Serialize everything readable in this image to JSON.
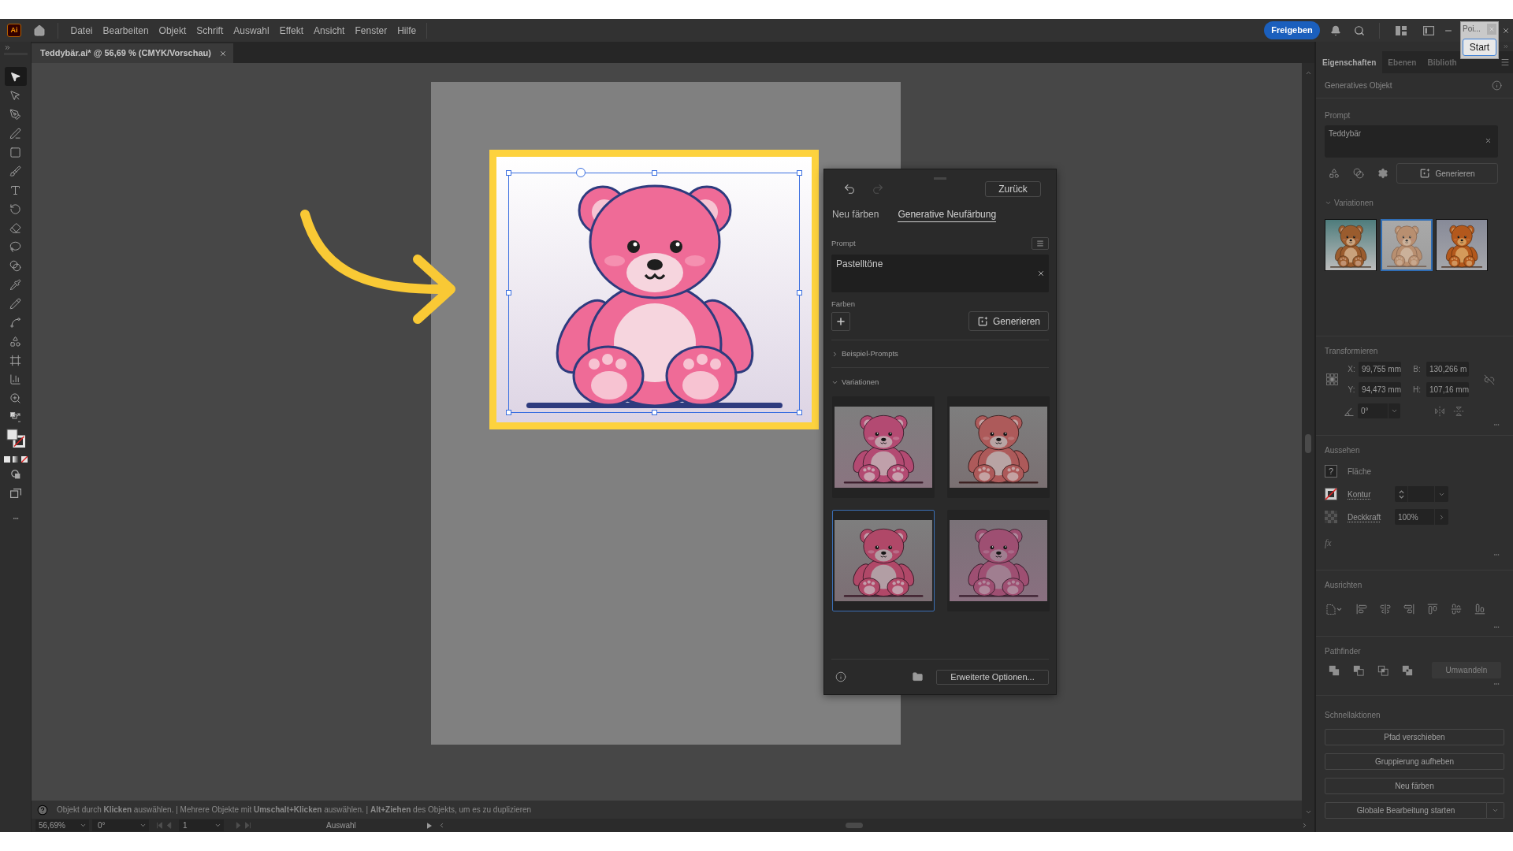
{
  "app_bar": {
    "logo": "Ai",
    "menu": [
      "Datei",
      "Bearbeiten",
      "Objekt",
      "Schrift",
      "Auswahl",
      "Effekt",
      "Ansicht",
      "Fenster",
      "Hilfe"
    ],
    "share_button": "Freigeben"
  },
  "popup": {
    "title": "Poi...",
    "button": "Start"
  },
  "document_tab": {
    "title": "Teddybär.ai* @ 56,69 % (CMYK/Vorschau)"
  },
  "tools": [
    {
      "kind": "selection",
      "selected": true
    },
    {
      "kind": "direct-selection",
      "selected": false
    },
    {
      "kind": "pen",
      "selected": false
    },
    {
      "kind": "curvature",
      "selected": false
    },
    {
      "kind": "rectangle",
      "selected": false
    },
    {
      "kind": "brush",
      "selected": false
    },
    {
      "kind": "type",
      "selected": false
    },
    {
      "kind": "rotate",
      "selected": false
    },
    {
      "kind": "eraser",
      "selected": false
    },
    {
      "kind": "lasso",
      "selected": false
    },
    {
      "kind": "gradient",
      "selected": false
    },
    {
      "kind": "eyedropper",
      "selected": false
    },
    {
      "kind": "pencil",
      "selected": false
    },
    {
      "kind": "width",
      "selected": false
    },
    {
      "kind": "shape-builder",
      "selected": false
    },
    {
      "kind": "artboard",
      "selected": false
    },
    {
      "kind": "chart",
      "selected": false
    },
    {
      "kind": "zoom",
      "selected": false
    }
  ],
  "recolor_panel": {
    "history": [
      {
        "kind": "undo",
        "disabled": false
      },
      {
        "kind": "redo",
        "disabled": true
      }
    ],
    "back_button": "Zurück",
    "tabs": [
      {
        "label": "Neu färben",
        "selected": false
      },
      {
        "label": "Generative Neufärbung",
        "selected": true
      }
    ],
    "prompt_label": "Prompt",
    "prompt": {
      "value": "Pastelltöne"
    },
    "colors_label": "Farben",
    "generate_button": "Generieren",
    "sections": [
      {
        "label": "Beispiel-Prompts",
        "expanded": false
      },
      {
        "label": "Variationen",
        "expanded": true,
        "variations": [
          {
            "selected": false
          },
          {
            "selected": false
          },
          {
            "selected": true
          },
          {
            "selected": false
          }
        ]
      }
    ],
    "advanced_button": "Erweiterte Optionen..."
  },
  "properties_panel": {
    "tabs": [
      {
        "label": "Eigenschaften",
        "selected": true
      },
      {
        "label": "Ebenen",
        "selected": false
      },
      {
        "label": "Biblioth",
        "selected": false
      }
    ],
    "object_type": "Generatives Objekt",
    "prompt_label": "Prompt",
    "prompt": {
      "value": "Teddybär"
    },
    "generate_button": "Generieren",
    "variations": {
      "label": "Variationen",
      "expanded": true,
      "items": [
        {
          "selected": false
        },
        {
          "selected": true
        },
        {
          "selected": false
        }
      ]
    },
    "transform": {
      "title": "Transformieren",
      "fields": [
        {
          "label": "X:",
          "value": "99,755 mm"
        },
        {
          "label": "B:",
          "value": "130,266 m"
        },
        {
          "label": "Y:",
          "value": "94,473 mm"
        },
        {
          "label": "H:",
          "value": "107,16 mm"
        }
      ],
      "angle": "0°"
    },
    "appearance": {
      "title": "Aussehen",
      "rows": [
        {
          "kind": "fill",
          "label": "Fläche",
          "swatch": "?"
        },
        {
          "kind": "stroke",
          "label": "Kontur"
        },
        {
          "kind": "opacity",
          "label": "Deckkraft",
          "value": "100%"
        }
      ],
      "effects_button": "fx"
    },
    "align": {
      "title": "Ausrichten"
    },
    "pathfinder": {
      "title": "Pathfinder",
      "button": {
        "label": "Umwandeln",
        "disabled": true
      }
    },
    "quick_actions": {
      "title": "Schnellaktionen",
      "buttons": [
        {
          "kind": "plain",
          "label": "Pfad verschieben"
        },
        {
          "kind": "plain",
          "label": "Gruppierung aufheben"
        },
        {
          "kind": "plain",
          "label": "Neu färben"
        },
        {
          "kind": "split",
          "label": "Globale Bearbeitung starten"
        }
      ]
    }
  },
  "status_bar": {
    "hint": "Objekt durch **Klicken** auswählen. | Mehrere Objekte mit **Umschalt+Klicken** auswählen. | **Alt+Ziehen** des Objekts, um es zu duplizieren",
    "zoom": "56,69%",
    "rotation": "0°",
    "page_nav": [
      {
        "kind": "first",
        "disabled": true
      },
      {
        "kind": "previous",
        "disabled": true
      },
      {
        "kind": "next",
        "disabled": true
      },
      {
        "kind": "last",
        "disabled": true
      }
    ],
    "artboard": "1",
    "tool": "Auswahl"
  }
}
